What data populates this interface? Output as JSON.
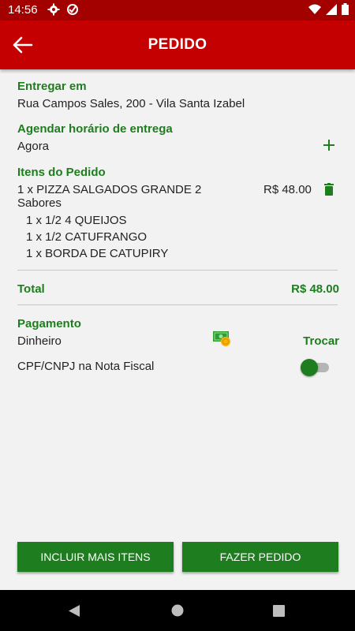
{
  "status_bar": {
    "time": "14:56"
  },
  "header": {
    "title": "PEDIDO"
  },
  "delivery": {
    "label": "Entregar em",
    "address": "Rua Campos Sales, 200 - Vila Santa Izabel"
  },
  "schedule": {
    "label": "Agendar horário de entrega",
    "value": "Agora"
  },
  "items": {
    "label": "Itens do Pedido",
    "list": [
      {
        "name_line1": "1 x PIZZA SALGADOS GRANDE 2",
        "name_line2": "Sabores",
        "price": "R$ 48.00",
        "details": [
          "1 x 1/2 4 QUEIJOS",
          "1 x 1/2 CATUFRANGO",
          "1 x BORDA DE CATUPIRY"
        ]
      }
    ]
  },
  "total": {
    "label": "Total",
    "value": "R$ 48.00"
  },
  "payment": {
    "label": "Pagamento",
    "method": "Dinheiro",
    "change_label": "Trocar"
  },
  "invoice": {
    "label": "CPF/CNPJ na Nota Fiscal",
    "enabled": false
  },
  "actions": {
    "add_more": "INCLUIR MAIS ITENS",
    "place_order": "FAZER PEDIDO"
  },
  "colors": {
    "primary": "#c40000",
    "status_bar": "#a30000",
    "accent": "#1e7d1e",
    "background": "#f2f2f2"
  }
}
